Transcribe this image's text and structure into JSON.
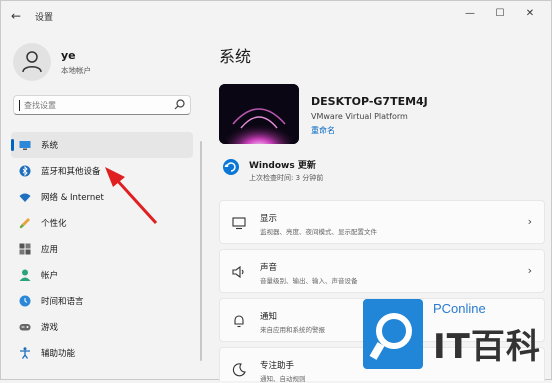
{
  "window": {
    "title": "设置",
    "controls": [
      "minimize-icon",
      "maximize-icon",
      "close-icon"
    ]
  },
  "user": {
    "name": "ye",
    "account_type": "本地帐户"
  },
  "search": {
    "placeholder": "查找设置"
  },
  "sidebar": {
    "items": [
      {
        "label": "系统",
        "icon": "monitor-icon",
        "selected": true
      },
      {
        "label": "蓝牙和其他设备",
        "icon": "bluetooth-icon"
      },
      {
        "label": "网络 & Internet",
        "icon": "wifi-icon"
      },
      {
        "label": "个性化",
        "icon": "brush-icon"
      },
      {
        "label": "应用",
        "icon": "apps-icon"
      },
      {
        "label": "帐户",
        "icon": "person-icon"
      },
      {
        "label": "时间和语言",
        "icon": "globe-clock-icon"
      },
      {
        "label": "游戏",
        "icon": "gamepad-icon"
      },
      {
        "label": "辅助功能",
        "icon": "accessibility-icon"
      }
    ]
  },
  "main": {
    "title": "系统",
    "device": {
      "name": "DESKTOP-G7TEM4J",
      "platform": "VMware Virtual Platform",
      "rename_label": "重命名"
    },
    "update": {
      "title": "Windows 更新",
      "subtitle": "上次检查时间: 3 分钟前"
    },
    "cards": [
      {
        "title": "显示",
        "subtitle": "监视器、亮度、夜间模式、显示配置文件",
        "icon": "display-icon"
      },
      {
        "title": "声音",
        "subtitle": "音量级别、输出、输入、声音设备",
        "icon": "speaker-icon"
      },
      {
        "title": "通知",
        "subtitle": "来自应用和系统的警报",
        "icon": "bell-icon"
      },
      {
        "title": "专注助手",
        "subtitle": "通知、自动规则",
        "icon": "moon-icon"
      }
    ]
  },
  "watermark": {
    "top": "PConline",
    "big": "IT百科"
  },
  "colors": {
    "accent": "#0067c0",
    "annotation_arrow": "#e02020",
    "watermark_blue": "#2185d8"
  }
}
